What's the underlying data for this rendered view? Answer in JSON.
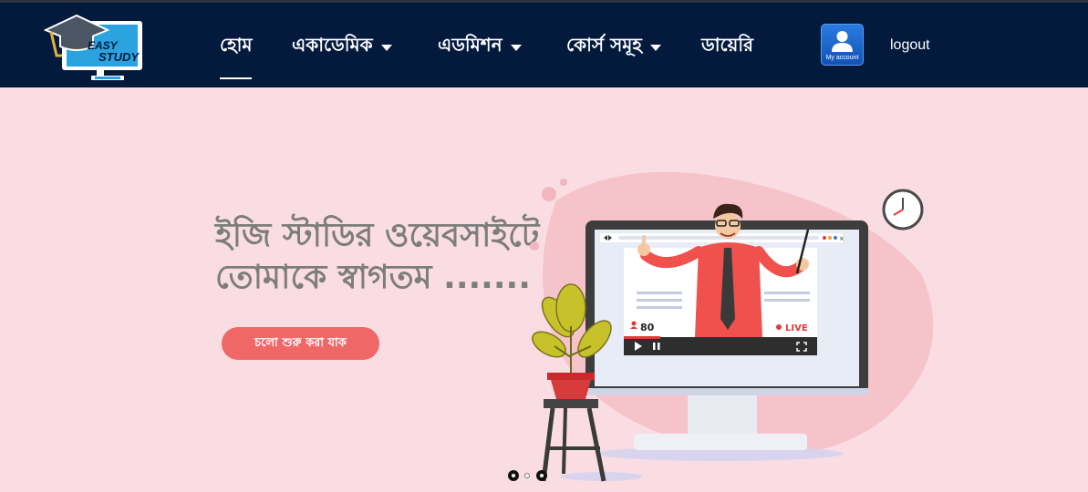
{
  "brand": {
    "logo_line1": "EASY",
    "logo_line2": "STUDY",
    "logo_icon": "graduation-cap-monitor-icon"
  },
  "nav": {
    "items": [
      {
        "label": "হোম",
        "active": true,
        "dropdown": false
      },
      {
        "label": "একাডেমিক",
        "dropdown": true
      },
      {
        "label": "এডমিশন",
        "dropdown": true
      },
      {
        "label": "কোর্স সমূহ",
        "dropdown": true
      },
      {
        "label": "ডায়েরি",
        "dropdown": false
      }
    ],
    "account_label": "My account",
    "account_icon": "user-icon",
    "logout_label": "logout"
  },
  "hero": {
    "title_line1": "ইজি স্টাডির ওয়েবসাইটে",
    "title_line2": "তোমাকে স্বাগতম .......",
    "cta_label": "চলো শুরু করা যাক",
    "illustration": {
      "viewer_count": "80",
      "live_label": "LIVE",
      "icons": [
        "clock-icon",
        "play-icon",
        "pause-icon",
        "fullscreen-icon",
        "user-icon",
        "plant-icon"
      ]
    }
  },
  "slider": {
    "dot_count": 3,
    "active_index": 0
  },
  "colors": {
    "navbar_bg": "#031a3d",
    "page_bg": "#f9dde2",
    "accent": "#f06767",
    "hero_text": "#7d7d7d",
    "account_blue": "#1e64cc"
  }
}
